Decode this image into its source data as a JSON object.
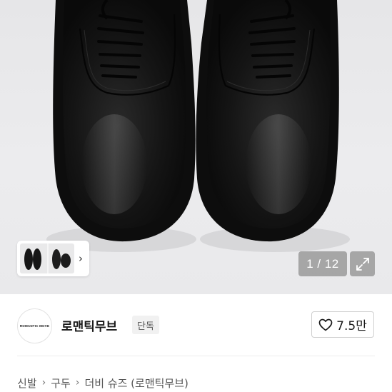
{
  "gallery": {
    "counter_text": "1 / 12",
    "thumbnail_next": "›"
  },
  "seller": {
    "logo_text": "ROMANTIC MOVE",
    "name": "로맨틱무브",
    "badge": "단독"
  },
  "like": {
    "count": "7.5만"
  },
  "breadcrumb": {
    "items": [
      "신발",
      "구두",
      "더비 슈즈 (로맨틱무브)"
    ],
    "separator": "›"
  },
  "colors": {
    "hero_background": "#e9e9eb",
    "shoe_leather": "#151515",
    "badge_background": "#f1f1f1",
    "text_primary": "#1a1a1a"
  },
  "icons": {
    "expand": "expand-icon",
    "heart": "heart-outline-icon",
    "chevron": "chevron-right-icon"
  }
}
